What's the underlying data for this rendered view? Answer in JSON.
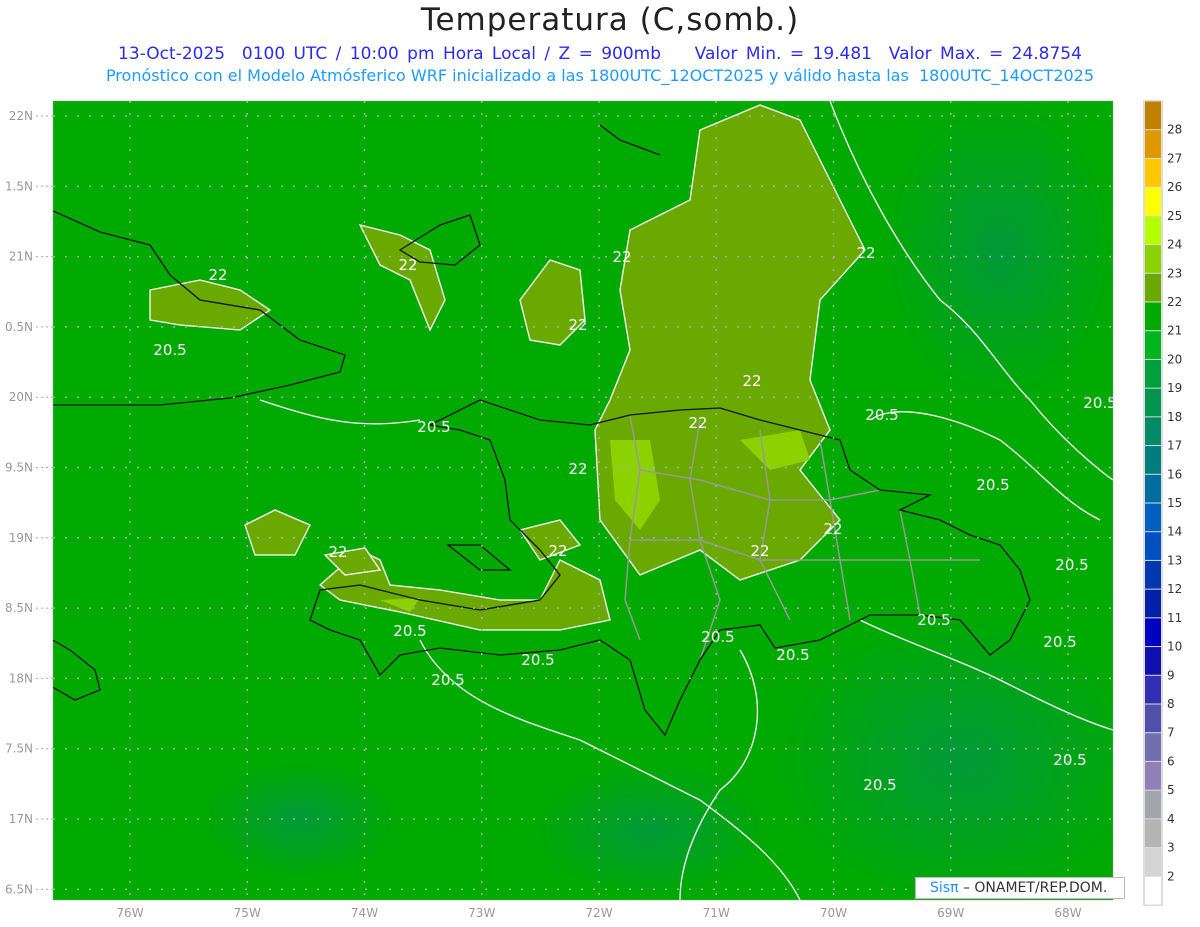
{
  "header": {
    "title": "Temperatura (C,somb.)",
    "line1": "13-Oct-2025  0100 UTC / 10:00 pm Hora Local / Z = 900mb    Valor Min. = 19.481  Valor Max. = 24.8754",
    "line2": "Pronóstico con el Modelo Atmósferico WRF inicializado a las 1800UTC_12OCT2025 y válido hasta las  1800UTC_14OCT2025"
  },
  "axes": {
    "lat_labels": [
      "22N",
      "1.5N",
      "21N",
      "0.5N",
      "20N",
      "9.5N",
      "19N",
      "8.5N",
      "18N",
      "7.5N",
      "17N",
      "6.5N"
    ],
    "lon_labels": [
      "76W",
      "75W",
      "74W",
      "73W",
      "72W",
      "71W",
      "70W",
      "69W",
      "68W"
    ]
  },
  "colorbar": {
    "labels": [
      "28",
      "27",
      "26",
      "25",
      "24",
      "23",
      "22",
      "21",
      "20",
      "19",
      "18",
      "17",
      "16",
      "15",
      "14",
      "13",
      "12",
      "11",
      "10",
      "9",
      "8",
      "7",
      "6",
      "5",
      "4",
      "3",
      "2"
    ],
    "colors": [
      "#c08000",
      "#e09800",
      "#ffc800",
      "#ffff00",
      "#b4ff00",
      "#8cd200",
      "#6aaa00",
      "#00aa00",
      "#00b41e",
      "#00a03c",
      "#009650",
      "#008a68",
      "#007e7e",
      "#006e9e",
      "#0060c0",
      "#0050c0",
      "#0038b0",
      "#0020a8",
      "#0000c0",
      "#1010b0",
      "#3030b0",
      "#5050aa",
      "#7070b0",
      "#9080b8",
      "#a4a4ae",
      "#b4b4b4",
      "#d4d4d4",
      "#ffffff"
    ]
  },
  "contour_labels": [
    "22",
    "22",
    "22",
    "22",
    "22",
    "22",
    "22",
    "22",
    "22",
    "22",
    "22",
    "22",
    "20.5",
    "20.5",
    "20.5",
    "20.5",
    "20.5",
    "20.5",
    "20.5",
    "20.5",
    "20.5",
    "20.5",
    "20.5",
    "20.5",
    "20.5",
    "20.5",
    "20.5"
  ],
  "credit": {
    "logo": "Sisπ",
    "text": "– ONAMET/REP.DOM."
  },
  "colors": {
    "base": "#00aa00",
    "olive": "#6aaa00",
    "light": "#8cd200",
    "dark": "#009a30"
  }
}
